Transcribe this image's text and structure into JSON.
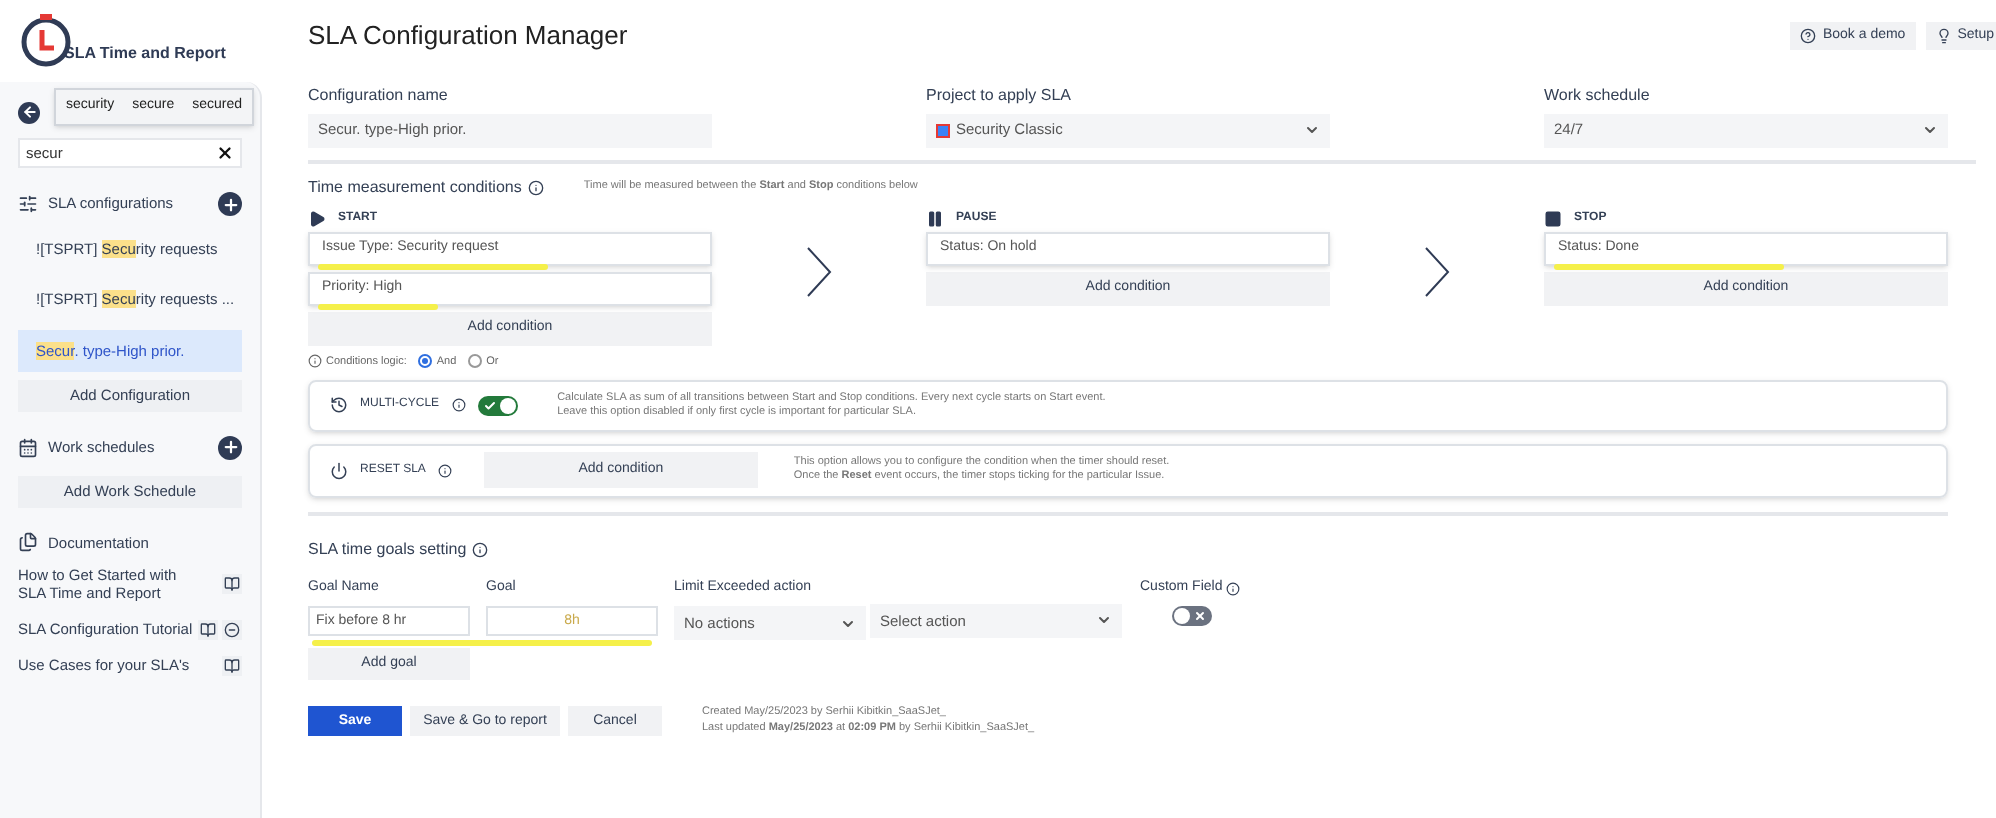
{
  "app": {
    "name": "SLA Time and Report"
  },
  "sidebar": {
    "search": {
      "value": "secur",
      "suggestions": [
        "security",
        "secure",
        "secured"
      ]
    },
    "configurations": {
      "title": "SLA configurations",
      "items": [
        {
          "prefix": "![TSPRT] ",
          "match": "Secu",
          "rest": "rity requests",
          "selected": false
        },
        {
          "prefix": "![TSPRT] ",
          "match": "Secu",
          "rest": "rity requests ...",
          "selected": false
        },
        {
          "match": "Secur",
          "rest": ". type-High prior.",
          "selected": true
        }
      ],
      "add": "Add Configuration"
    },
    "schedules": {
      "title": "Work schedules",
      "add": "Add Work Schedule"
    },
    "documentation": {
      "title": "Documentation",
      "items": [
        {
          "label": "How to Get Started with SLA Time and Report",
          "video": false
        },
        {
          "label": "SLA Configuration Tutorial",
          "video": true
        },
        {
          "label": "Use Cases for your SLA's",
          "video": false
        }
      ]
    }
  },
  "header": {
    "title": "SLA Configuration Manager",
    "buttons": [
      {
        "kind": "help",
        "label": "Book a demo"
      },
      {
        "kind": "bulb",
        "label": "Setup"
      }
    ]
  },
  "config": {
    "name_label": "Configuration name",
    "name_value": "Secur. type-High prior.",
    "project_label": "Project to apply SLA",
    "project_value": "Security Classic",
    "schedule_label": "Work schedule",
    "schedule_value": "24/7"
  },
  "conditions": {
    "title": "Time measurement conditions",
    "note": "Time will be measured between the **Start** and **Stop** conditions below",
    "columns": [
      {
        "kind": "start",
        "title": "START",
        "items": [
          {
            "text": "Issue Type: Security request",
            "marked": true
          },
          {
            "text": "Priority: High",
            "marked": true
          }
        ],
        "add": "Add condition"
      },
      {
        "kind": "pause",
        "title": "PAUSE",
        "items": [
          {
            "text": "Status: On hold",
            "marked": false
          }
        ],
        "add": "Add condition"
      },
      {
        "kind": "stop",
        "title": "STOP",
        "items": [
          {
            "text": "Status: Done",
            "marked": true
          }
        ],
        "add": "Add condition"
      }
    ],
    "logic": {
      "label": "Conditions logic:",
      "options": [
        {
          "label": "And",
          "selected": true
        },
        {
          "label": "Or",
          "selected": false
        }
      ]
    }
  },
  "multicycle": {
    "label": "MULTI-CYCLE",
    "on": true,
    "description": "Calculate SLA as sum of all transitions between Start and Stop conditions. Every next cycle starts on Start event.\nLeave this option disabled if only first cycle is important for particular SLA."
  },
  "reset": {
    "label": "RESET SLA",
    "button": "Add condition",
    "description": "This option allows you to configure the condition when the timer should reset.\nOnce the **Reset** event occurs, the timer stops ticking for the particular Issue."
  },
  "goals": {
    "title": "SLA time goals setting",
    "columns": [
      "Goal Name",
      "Goal",
      "Limit Exceeded action",
      "Custom Field"
    ],
    "row": {
      "name": "Fix before 8 hr",
      "goal": "8h",
      "action": "No actions",
      "action2": "Select action",
      "custom_field": false,
      "marked": true
    },
    "add": "Add goal"
  },
  "footer": {
    "save": "Save",
    "save_report": "Save & Go to report",
    "cancel": "Cancel",
    "created": "Created May/25/2023 by Serhii Kibitkin_SaaSJet_",
    "updated": "Last updated **May/25/2023** at **02:09 PM** by Serhii Kibitkin_SaaSJet_"
  }
}
